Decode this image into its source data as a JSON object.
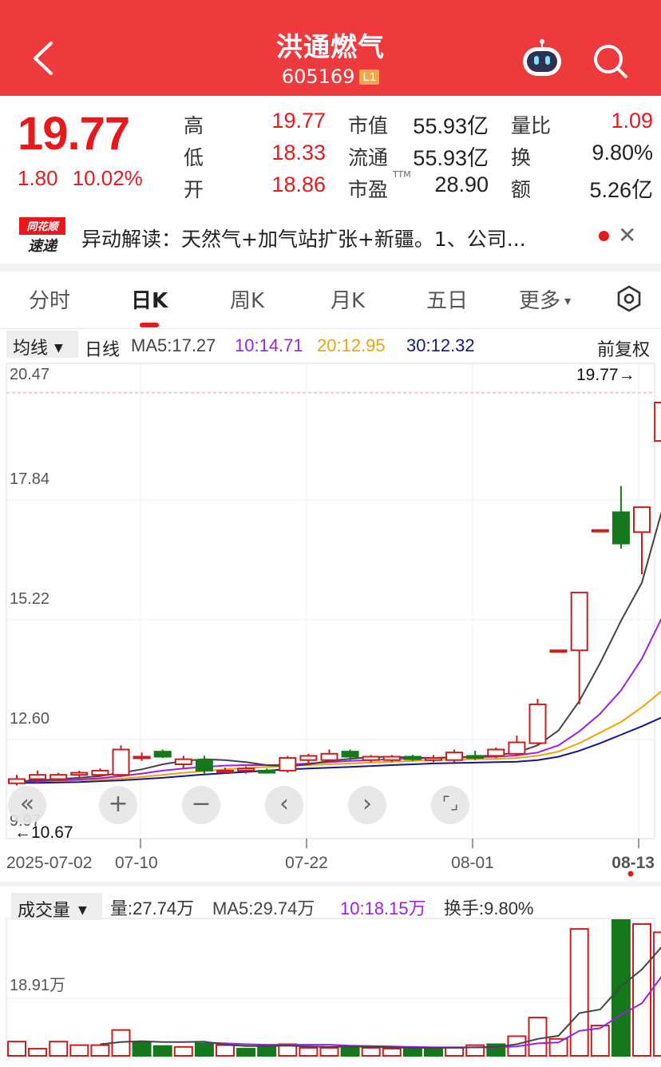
{
  "header": {
    "title": "洪通燃气",
    "code": "605169",
    "level_badge": "L1"
  },
  "quote": {
    "price": "19.77",
    "change": "1.80",
    "change_pct": "10.02%",
    "stats": [
      {
        "label": "高",
        "value": "19.77",
        "color": "#e8191c"
      },
      {
        "label": "低",
        "value": "18.33",
        "color": "#e8191c"
      },
      {
        "label": "开",
        "value": "18.86",
        "color": "#e8191c"
      },
      {
        "label": "市值",
        "value": "55.93亿",
        "color": "#222222"
      },
      {
        "label": "流通",
        "value": "55.93亿",
        "color": "#222222"
      },
      {
        "label": "市盈",
        "sup": "TTM",
        "value": "28.90",
        "color": "#222222"
      },
      {
        "label": "量比",
        "value": "1.09",
        "color": "#e8191c"
      },
      {
        "label": "换",
        "value": "9.80%",
        "color": "#222222"
      },
      {
        "label": "额",
        "value": "5.26亿",
        "color": "#222222"
      }
    ]
  },
  "news": {
    "logo_top": "同花顺",
    "logo_bottom": "速递",
    "text": "异动解读：天然气+加气站扩张+新疆。1、公司..."
  },
  "tabs": [
    "分时",
    "日K",
    "周K",
    "月K",
    "五日",
    "更多"
  ],
  "active_tab": "日K",
  "ma": {
    "selector": "均线",
    "period": "日线",
    "ma5": "MA5:17.27",
    "ma10": "10:14.71",
    "ma20": "20:12.95",
    "ma30": "30:12.32",
    "adjust": "前复权"
  },
  "colors": {
    "up": "#cc1d1d",
    "down": "#14791a",
    "ma5": "#444444",
    "ma10": "#9b1fe8",
    "ma20": "#f0a20d",
    "ma30": "#16168a",
    "header": "#ee3a3d"
  },
  "volume_head": {
    "selector": "成交量",
    "vol": "量:27.74万",
    "ma5": "MA5:29.74万",
    "ma10": "10:18.15万",
    "turnover": "换手:9.80%"
  },
  "chart_data": [
    {
      "type": "candlestick",
      "y_ticks": [
        "20.47",
        "17.84",
        "15.22",
        "12.60",
        "9.97"
      ],
      "ylim": [
        9.97,
        20.47
      ],
      "high_marker": "19.77→",
      "low_marker": "←10.67",
      "x_labels": [
        "2025-07-02",
        "07-10",
        "07-22",
        "08-01",
        "08-13"
      ],
      "candles": [
        {
          "o": 10.75,
          "h": 10.95,
          "l": 10.7,
          "c": 10.85
        },
        {
          "o": 10.85,
          "h": 11.05,
          "l": 10.75,
          "c": 10.95
        },
        {
          "o": 10.85,
          "h": 11.0,
          "l": 10.8,
          "c": 10.95
        },
        {
          "o": 10.95,
          "h": 11.05,
          "l": 10.85,
          "c": 11.0
        },
        {
          "o": 10.95,
          "h": 11.1,
          "l": 10.9,
          "c": 11.05
        },
        {
          "o": 10.95,
          "h": 11.65,
          "l": 10.9,
          "c": 11.55
        },
        {
          "o": 11.38,
          "h": 11.48,
          "l": 11.28,
          "c": 11.38
        },
        {
          "o": 11.5,
          "h": 11.55,
          "l": 11.35,
          "c": 11.38
        },
        {
          "o": 11.2,
          "h": 11.4,
          "l": 11.1,
          "c": 11.32
        },
        {
          "o": 11.3,
          "h": 11.4,
          "l": 10.98,
          "c": 11.05
        },
        {
          "o": 11.05,
          "h": 11.12,
          "l": 10.98,
          "c": 11.05
        },
        {
          "o": 11.05,
          "h": 11.15,
          "l": 10.98,
          "c": 11.1
        },
        {
          "o": 11.05,
          "h": 11.1,
          "l": 10.98,
          "c": 11.0
        },
        {
          "o": 11.05,
          "h": 11.4,
          "l": 11.0,
          "c": 11.35
        },
        {
          "o": 11.3,
          "h": 11.45,
          "l": 11.2,
          "c": 11.4
        },
        {
          "o": 11.3,
          "h": 11.55,
          "l": 11.25,
          "c": 11.45
        },
        {
          "o": 11.5,
          "h": 11.55,
          "l": 11.3,
          "c": 11.38
        },
        {
          "o": 11.3,
          "h": 11.42,
          "l": 11.25,
          "c": 11.38
        },
        {
          "o": 11.3,
          "h": 11.42,
          "l": 11.25,
          "c": 11.38
        },
        {
          "o": 11.38,
          "h": 11.42,
          "l": 11.28,
          "c": 11.32
        },
        {
          "o": 11.3,
          "h": 11.42,
          "l": 11.25,
          "c": 11.35
        },
        {
          "o": 11.3,
          "h": 11.55,
          "l": 11.25,
          "c": 11.48
        },
        {
          "o": 11.4,
          "h": 11.52,
          "l": 11.3,
          "c": 11.35
        },
        {
          "o": 11.4,
          "h": 11.6,
          "l": 11.35,
          "c": 11.55
        },
        {
          "o": 11.45,
          "h": 11.88,
          "l": 11.4,
          "c": 11.72
        },
        {
          "o": 11.7,
          "h": 12.75,
          "l": 11.65,
          "c": 12.62
        },
        {
          "o": 13.9,
          "h": 13.9,
          "l": 13.9,
          "c": 13.9
        },
        {
          "o": 13.9,
          "h": 15.27,
          "l": 12.62,
          "c": 15.27
        },
        {
          "o": 16.75,
          "h": 16.75,
          "l": 16.75,
          "c": 16.75
        },
        {
          "o": 17.17,
          "h": 17.79,
          "l": 16.31,
          "c": 16.43
        },
        {
          "o": 16.7,
          "h": 17.29,
          "l": 15.7,
          "c": 17.29
        },
        {
          "o": 18.86,
          "h": 19.77,
          "l": 18.33,
          "c": 19.77
        }
      ],
      "ma5_line": [
        10.8,
        10.82,
        10.85,
        10.88,
        10.92,
        11.0,
        11.08,
        11.2,
        11.28,
        11.32,
        11.3,
        11.25,
        11.18,
        11.15,
        11.2,
        11.28,
        11.33,
        11.37,
        11.38,
        11.36,
        11.35,
        11.37,
        11.38,
        11.42,
        11.48,
        11.65,
        12.0,
        12.7,
        13.6,
        14.6,
        15.5,
        17.27
      ],
      "ma10_line": [
        10.78,
        10.8,
        10.82,
        10.84,
        10.87,
        10.92,
        10.98,
        11.05,
        11.1,
        11.14,
        11.17,
        11.18,
        11.18,
        11.19,
        11.22,
        11.25,
        11.28,
        11.3,
        11.32,
        11.34,
        11.35,
        11.36,
        11.37,
        11.38,
        11.41,
        11.48,
        11.65,
        11.98,
        12.4,
        12.95,
        13.7,
        14.71
      ],
      "ma20_line": [
        10.8,
        10.8,
        10.81,
        10.82,
        10.84,
        10.86,
        10.9,
        10.95,
        11.0,
        11.04,
        11.08,
        11.11,
        11.14,
        11.16,
        11.18,
        11.2,
        11.22,
        11.24,
        11.26,
        11.28,
        11.3,
        11.31,
        11.32,
        11.33,
        11.35,
        11.4,
        11.5,
        11.7,
        11.95,
        12.2,
        12.55,
        12.95
      ],
      "ma30_line": [
        10.76,
        10.76,
        10.77,
        10.78,
        10.8,
        10.82,
        10.85,
        10.88,
        10.92,
        10.96,
        10.99,
        11.02,
        11.05,
        11.08,
        11.1,
        11.12,
        11.14,
        11.16,
        11.18,
        11.2,
        11.22,
        11.23,
        11.24,
        11.25,
        11.26,
        11.3,
        11.38,
        11.52,
        11.7,
        11.9,
        12.1,
        12.32
      ]
    },
    {
      "type": "bar",
      "y_tick": "18.91万",
      "values_wan": [
        3.2,
        1.6,
        3.2,
        2.4,
        2.4,
        5.8,
        3.0,
        2.2,
        2.0,
        2.8,
        2.4,
        1.6,
        2.2,
        2.6,
        1.8,
        1.8,
        2.2,
        1.8,
        1.6,
        1.8,
        1.6,
        1.8,
        2.4,
        2.6,
        4.4,
        8.6,
        3.8,
        28.5,
        6.8,
        30.5,
        29.6,
        27.74
      ],
      "up": [
        true,
        true,
        true,
        true,
        true,
        true,
        false,
        false,
        true,
        false,
        true,
        false,
        false,
        true,
        true,
        true,
        false,
        true,
        true,
        false,
        false,
        true,
        true,
        false,
        true,
        true,
        true,
        true,
        true,
        false,
        true,
        true
      ],
      "ma5_wan": [
        null,
        null,
        null,
        null,
        2.6,
        3.1,
        3.3,
        3.1,
        3.1,
        3.2,
        2.5,
        2.2,
        2.2,
        2.3,
        2.1,
        2.0,
        2.1,
        2.0,
        1.9,
        1.8,
        1.8,
        1.8,
        1.9,
        2.0,
        2.6,
        3.8,
        4.5,
        9.6,
        10.4,
        15.6,
        19.4,
        24.7
      ],
      "ma10_wan": [
        null,
        null,
        null,
        null,
        null,
        null,
        null,
        null,
        null,
        3.0,
        2.8,
        2.6,
        2.5,
        2.5,
        2.5,
        2.5,
        2.3,
        2.2,
        2.1,
        2.0,
        1.9,
        1.9,
        1.9,
        1.9,
        2.1,
        2.8,
        3.0,
        5.6,
        6.2,
        9.2,
        11.8,
        18.15
      ]
    }
  ]
}
